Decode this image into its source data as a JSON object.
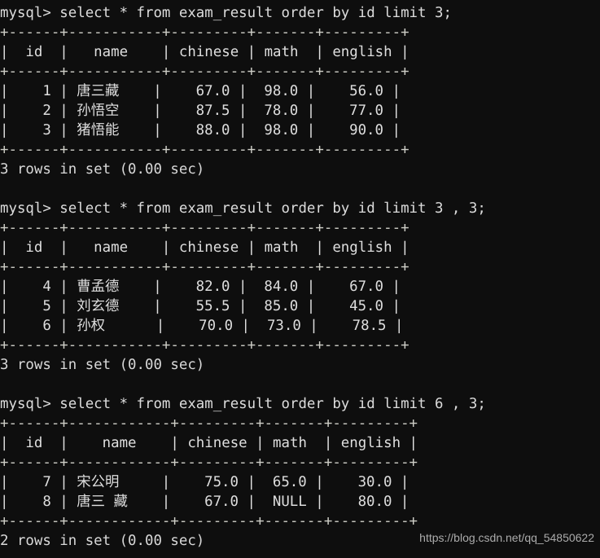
{
  "terminal": {
    "background_color": "#0e0e0e",
    "foreground_color": "#d4d4d4",
    "rule_color": "#cfcfc8",
    "watermark": "https://blog.csdn.net/qq_54850622",
    "lines": [
      "mysql> select * from exam_result order by id limit 3;",
      "+------+-----------+---------+-------+---------+",
      "|  id  |   name    | chinese | math  | english |",
      "+------+-----------+---------+-------+---------+",
      "|    1 | 唐三藏    |    67.0 |  98.0 |    56.0 |",
      "|    2 | 孙悟空    |    87.5 |  78.0 |    77.0 |",
      "|    3 | 猪悟能    |    88.0 |  98.0 |    90.0 |",
      "+------+-----------+---------+-------+---------+",
      "3 rows in set (0.00 sec)",
      "",
      "mysql> select * from exam_result order by id limit 3 , 3;",
      "+------+-----------+---------+-------+---------+",
      "|  id  |   name    | chinese | math  | english |",
      "+------+-----------+---------+-------+---------+",
      "|    4 | 曹孟德    |    82.0 |  84.0 |    67.0 |",
      "|    5 | 刘玄德    |    55.5 |  85.0 |    45.0 |",
      "|    6 | 孙权      |    70.0 |  73.0 |    78.5 |",
      "+------+-----------+---------+-------+---------+",
      "3 rows in set (0.00 sec)",
      "",
      "mysql> select * from exam_result order by id limit 6 , 3;",
      "+------+------------+---------+-------+---------+",
      "|  id  |    name    | chinese | math  | english |",
      "+------+------------+---------+-------+---------+",
      "|    7 | 宋公明     |    75.0 |  65.0 |    30.0 |",
      "|    8 | 唐三 藏    |    67.0 |  NULL |    80.0 |",
      "+------+------------+---------+-------+---------+",
      "2 rows in set (0.00 sec)"
    ],
    "queries": [
      {
        "prompt": "mysql>",
        "sql": "select * from exam_result order by id limit 3;",
        "columns": [
          "id",
          "name",
          "chinese",
          "math",
          "english"
        ],
        "rows": [
          [
            "1",
            "唐三藏",
            "67.0",
            "98.0",
            "56.0"
          ],
          [
            "2",
            "孙悟空",
            "87.5",
            "78.0",
            "77.0"
          ],
          [
            "3",
            "猪悟能",
            "88.0",
            "98.0",
            "90.0"
          ]
        ],
        "status": "3 rows in set (0.00 sec)"
      },
      {
        "prompt": "mysql>",
        "sql": "select * from exam_result order by id limit 3 , 3;",
        "columns": [
          "id",
          "name",
          "chinese",
          "math",
          "english"
        ],
        "rows": [
          [
            "4",
            "曹孟德",
            "82.0",
            "84.0",
            "67.0"
          ],
          [
            "5",
            "刘玄德",
            "55.5",
            "85.0",
            "45.0"
          ],
          [
            "6",
            "孙权",
            "70.0",
            "73.0",
            "78.5"
          ]
        ],
        "status": "3 rows in set (0.00 sec)"
      },
      {
        "prompt": "mysql>",
        "sql": "select * from exam_result order by id limit 6 , 3;",
        "columns": [
          "id",
          "name",
          "chinese",
          "math",
          "english"
        ],
        "rows": [
          [
            "7",
            "宋公明",
            "75.0",
            "65.0",
            "30.0"
          ],
          [
            "8",
            "唐三 藏",
            "67.0",
            "NULL",
            "80.0"
          ]
        ],
        "status": "2 rows in set (0.00 sec)"
      }
    ]
  }
}
